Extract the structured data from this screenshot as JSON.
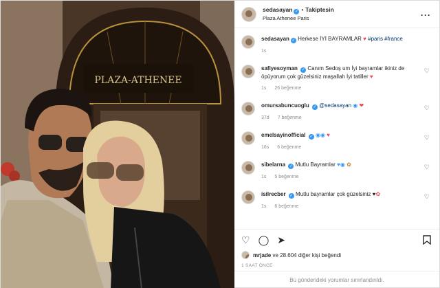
{
  "post": {
    "username": "sedasayan",
    "follow_label": "Takiptesin",
    "location": "Plaza Athenee Paris",
    "photo_sign": "PLAZA-ATHENEE"
  },
  "caption": {
    "username": "sedasayan",
    "text": "Herkese İYİ BAYRAMLAR",
    "hashtags": "#paris #france",
    "age": "1s"
  },
  "comments": [
    {
      "username": "safiyesoyman",
      "text": "Canım Sedoş um İyi bayramlar ikiniz de öpüyorum çok güzelsiniz maşallah İyi tatiller",
      "age": "1s",
      "likes": "26 beğenme"
    },
    {
      "username": "omursabuncuoglu",
      "text": "@sedasayan",
      "age": "37d",
      "likes": "7 beğenme"
    },
    {
      "username": "emelsayinofficial",
      "text": "",
      "age": "16s",
      "likes": "6 beğenme"
    },
    {
      "username": "sibelarna",
      "text": "Mutlu Bayramlar",
      "age": "1s",
      "likes": "5 beğenme"
    },
    {
      "username": "isilrecber",
      "text": "Mutlu bayramlar çok güzelsiniz",
      "age": "1s",
      "likes": "6 beğenme"
    }
  ],
  "likes_line": {
    "user": "mrjade",
    "rest": " ve 28.604 diğer kişi beğendi"
  },
  "timestamp": "1 SAAT ÖNCE",
  "limited_text": "Bu gönderideki yorumlar sınırlandırıldı.",
  "colors": {
    "verified": "#3897f0",
    "heart": "#ed4956",
    "link": "#00376b"
  },
  "icons": [
    "heart-icon",
    "comment-icon",
    "share-icon",
    "bookmark-icon",
    "more-icon"
  ]
}
